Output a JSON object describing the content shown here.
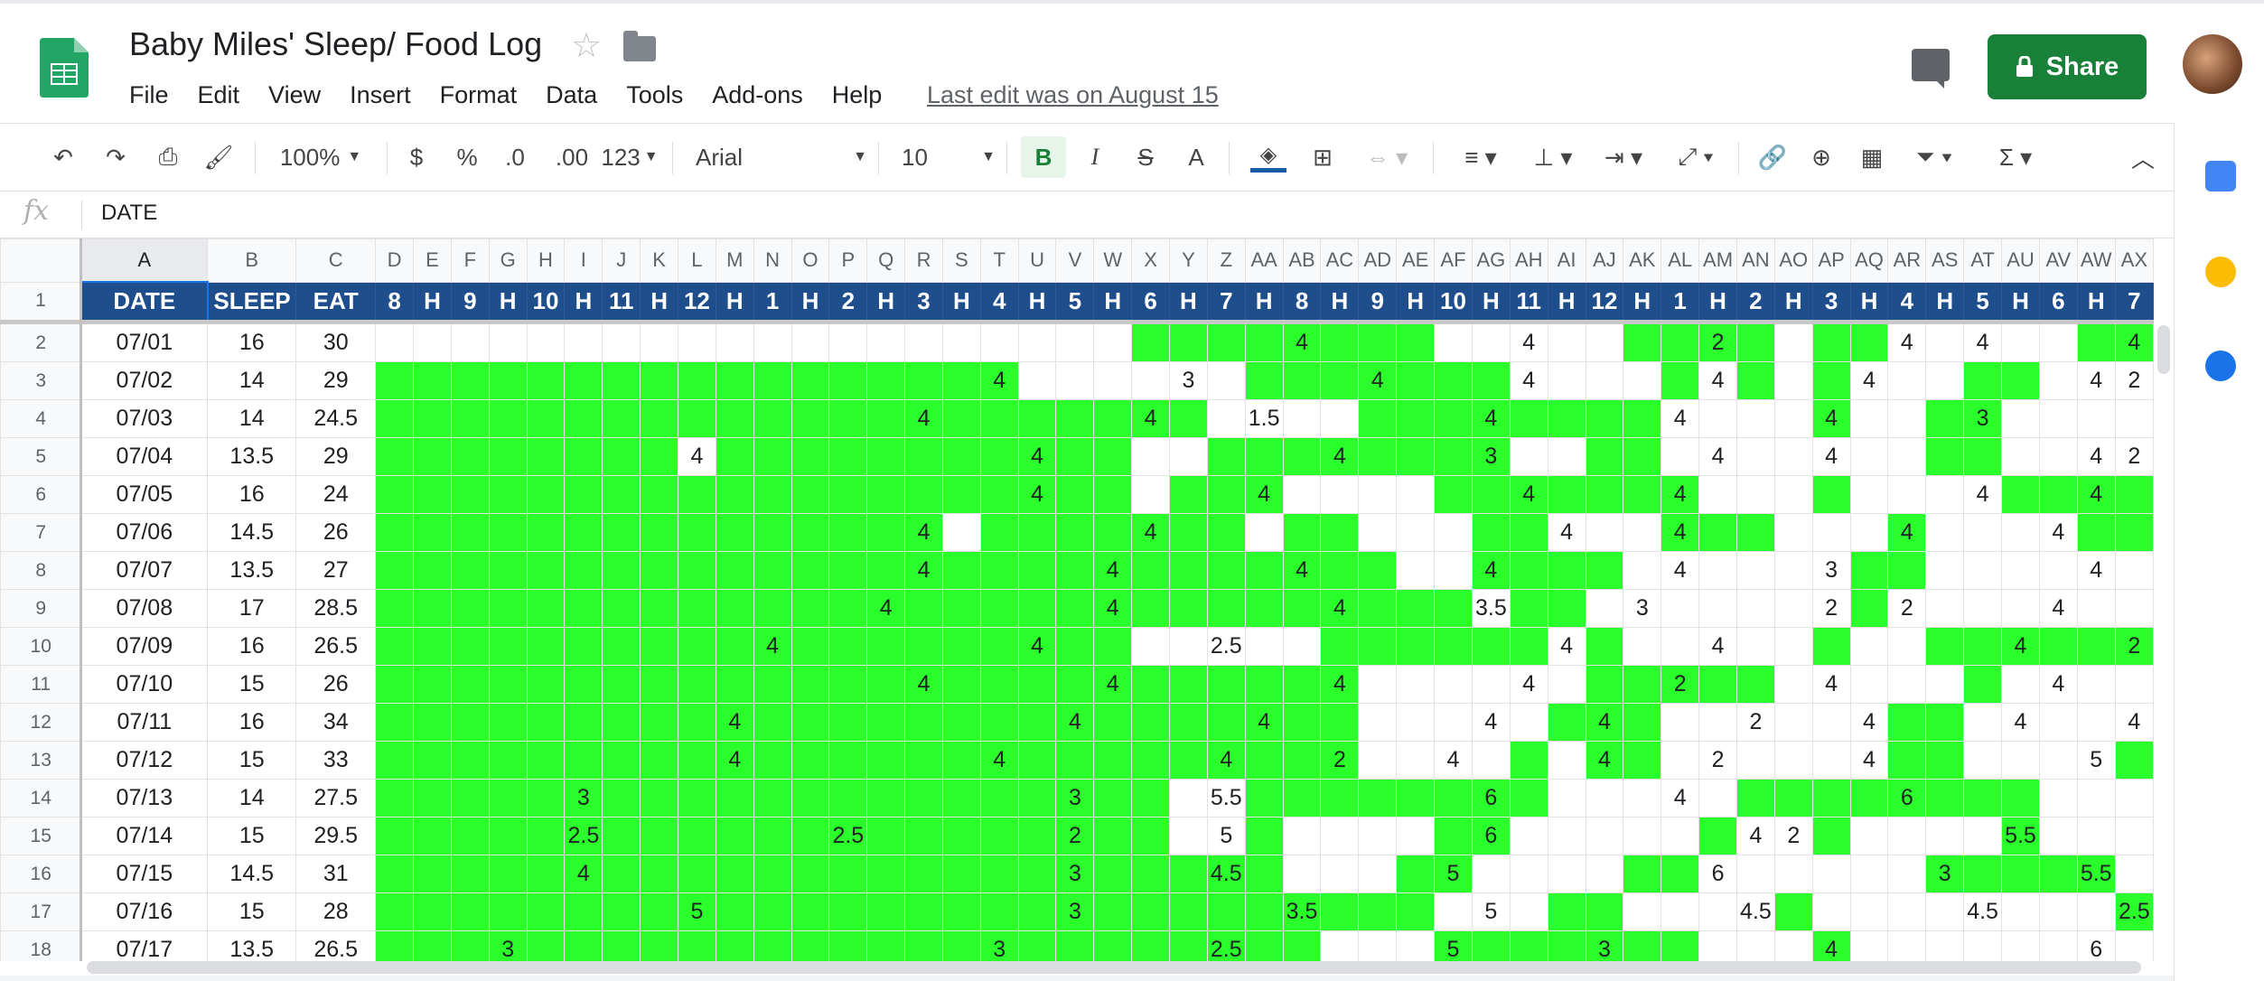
{
  "app": {
    "doc_title": "Baby Miles' Sleep/ Food Log",
    "menu": [
      "File",
      "Edit",
      "View",
      "Insert",
      "Format",
      "Data",
      "Tools",
      "Add-ons",
      "Help"
    ],
    "last_edit": "Last edit was on August 15",
    "share_label": "Share",
    "brand_color": "#188038"
  },
  "toolbar": {
    "zoom": "100%",
    "currency": "$",
    "percent": "%",
    "dec_less": ".0",
    "dec_more": ".00",
    "more_formats": "123",
    "font": "Arial",
    "font_size": "10",
    "bold": "B",
    "italic": "I",
    "strike": "S",
    "text_color": "A"
  },
  "formula_bar": {
    "fx": "fx",
    "value": "DATE"
  },
  "colors": {
    "header_fill": "#1f4e8c",
    "sleep_fill": "#2bff2b"
  },
  "sheet": {
    "columns": [
      "A",
      "B",
      "C",
      "D",
      "E",
      "F",
      "G",
      "H",
      "I",
      "J",
      "K",
      "L",
      "M",
      "N",
      "O",
      "P",
      "Q",
      "R",
      "S",
      "T",
      "U",
      "V",
      "W",
      "X",
      "Y",
      "Z",
      "AA",
      "AB",
      "AC",
      "AD",
      "AE",
      "AF",
      "AG",
      "AH",
      "AI",
      "AJ",
      "AK",
      "AL",
      "AM",
      "AN",
      "AO",
      "AP",
      "AQ",
      "AR",
      "AS",
      "AT",
      "AU",
      "AV",
      "AW",
      "AX"
    ],
    "header_row": [
      "DATE",
      "SLEEP",
      "EAT",
      "8",
      "H",
      "9",
      "H",
      "10",
      "H",
      "11",
      "H",
      "12",
      "H",
      "1",
      "H",
      "2",
      "H",
      "3",
      "H",
      "4",
      "H",
      "5",
      "H",
      "6",
      "H",
      "7",
      "H",
      "8",
      "H",
      "9",
      "H",
      "10",
      "H",
      "11",
      "H",
      "12",
      "H",
      "1",
      "H",
      "2",
      "H",
      "3",
      "H",
      "4",
      "H",
      "5",
      "H",
      "6",
      "H",
      "7"
    ],
    "rows": [
      {
        "n": "2",
        "date": "07/01",
        "sleep": "16",
        "eat": "30",
        "fill": "0000000000000000000011111111000001111011000001100001",
        "vals": {
          "AB": "4",
          "AH": "4",
          "AM": "2",
          "AR": "4",
          "AT": "4",
          "AX": "4"
        }
      },
      {
        "n": "3",
        "date": "07/02",
        "sleep": "14",
        "eat": "29",
        "fill": "1111111111111111100000011111110000101010001100000001",
        "vals": {
          "T": "4",
          "Y": "3",
          "AD": "4",
          "AH": "4",
          "AM": "4",
          "AQ": "4",
          "AW": "4",
          "AX": "2"
        }
      },
      {
        "n": "4",
        "date": "07/03",
        "sleep": "14",
        "eat": "24.5",
        "fill": "1111111111111111111111000011111111000010011000000001",
        "vals": {
          "R": "4",
          "X": "4",
          "AA": "1.5",
          "AG": "4",
          "AL": "4",
          "AP": "4",
          "AT": "3"
        }
      },
      {
        "n": "5",
        "date": "07/04",
        "sleep": "13.5",
        "eat": "29",
        "fill": "1111111101111111111100111111110011000000011000010000",
        "vals": {
          "L": "4",
          "U": "4",
          "AC": "4",
          "AG": "3",
          "AM": "4",
          "AP": "4",
          "AW": "4",
          "AX": "2"
        }
      },
      {
        "n": "6",
        "date": "07/05",
        "sleep": "16",
        "eat": "24",
        "fill": "1111111111111111111101110000111111100010000111110001",
        "vals": {
          "U": "4",
          "AA": "4",
          "AH": "4",
          "AL": "4",
          "AT": "4",
          "AW": "4"
        }
      },
      {
        "n": "7",
        "date": "07/06",
        "sleep": "14.5",
        "eat": "26",
        "fill": "1111111111111110111111101100011000111000100001111000",
        "vals": {
          "R": "4",
          "X": "4",
          "AI": "4",
          "AL": "4",
          "AR": "4",
          "AV": "4"
        }
      },
      {
        "n": "8",
        "date": "07/07",
        "sleep": "13.5",
        "eat": "27",
        "fill": "1111111111111111111111111110011110000001100000000000",
        "vals": {
          "R": "4",
          "W": "4",
          "AB": "4",
          "AG": "4",
          "AL": "4",
          "AP": "3",
          "AW": "4"
        }
      },
      {
        "n": "9",
        "date": "07/08",
        "sleep": "17",
        "eat": "28.5",
        "fill": "1111111111111111111111111111101100000001000000001111",
        "vals": {
          "Q": "4",
          "W": "4",
          "AC": "4",
          "AG": "3.5",
          "AK": "3",
          "AP": "2",
          "AR": "2",
          "AV": "4"
        }
      },
      {
        "n": "10",
        "date": "07/09",
        "sleep": "16",
        "eat": "26.5",
        "fill": "1111111111111111111100000111111010000010011111111001",
        "vals": {
          "N": "4",
          "U": "4",
          "Z": "2.5",
          "AI": "4",
          "AM": "4",
          "AU": "4",
          "AX": "2"
        }
      },
      {
        "n": "11",
        "date": "07/10",
        "sleep": "15",
        "eat": "26",
        "fill": "1111111111111111111111111100000011111000001000001000",
        "vals": {
          "R": "4",
          "W": "4",
          "AC": "4",
          "AH": "4",
          "AL": "2",
          "AP": "4",
          "AV": "4"
        }
      },
      {
        "n": "12",
        "date": "07/11",
        "sleep": "16",
        "eat": "34",
        "fill": "1111111111111111111111111100000111000000110000000001",
        "vals": {
          "M": "4",
          "V": "4",
          "AA": "4",
          "AG": "4",
          "AJ": "4",
          "AN": "2",
          "AQ": "4",
          "AU": "4",
          "AX": "4"
        }
      },
      {
        "n": "13",
        "date": "07/12",
        "sleep": "15",
        "eat": "33",
        "fill": "1111111111111111111111111100001011000000110000100001",
        "vals": {
          "M": "4",
          "T": "4",
          "Z": "4",
          "AC": "2",
          "AF": "4",
          "AJ": "4",
          "AM": "2",
          "AQ": "4",
          "AW": "5"
        }
      },
      {
        "n": "14",
        "date": "07/13",
        "sleep": "14",
        "eat": "27.5",
        "fill": "1111111111111111111110011111111000001111111100000001",
        "vals": {
          "I": "3",
          "V": "3",
          "Z": "5.5",
          "AG": "6",
          "AL": "4",
          "AR": "6"
        }
      },
      {
        "n": "15",
        "date": "07/14",
        "sleep": "15",
        "eat": "29.5",
        "fill": "1111111111111111111110010000110000010010000100000111",
        "vals": {
          "I": "2.5",
          "P": "2.5",
          "V": "2",
          "Z": "5",
          "AG": "6",
          "AN": "4",
          "AO": "2",
          "AU": "5.5"
        }
      },
      {
        "n": "16",
        "date": "07/15",
        "sleep": "14.5",
        "eat": "31",
        "fill": "1111111111111111111111110001100001100000011111000001",
        "vals": {
          "I": "4",
          "V": "3",
          "Z": "4.5",
          "AF": "5",
          "AM": "6",
          "AS": "3",
          "AW": "5.5"
        }
      },
      {
        "n": "17",
        "date": "07/16",
        "sleep": "15",
        "eat": "28",
        "fill": "1111111111111111111111111111000110000100000000100000",
        "vals": {
          "L": "5",
          "V": "3",
          "AB": "3.5",
          "AG": "5",
          "AN": "4.5",
          "AT": "4.5",
          "AX": "2.5"
        }
      },
      {
        "n": "18",
        "date": "07/17",
        "sleep": "13.5",
        "eat": "26.5",
        "fill": "1111111111111111111111111000111111100010000000000000",
        "vals": {
          "G": "3",
          "T": "3",
          "Z": "2.5",
          "AF": "5",
          "AJ": "3",
          "AP": "4",
          "AW": "6"
        }
      }
    ]
  }
}
